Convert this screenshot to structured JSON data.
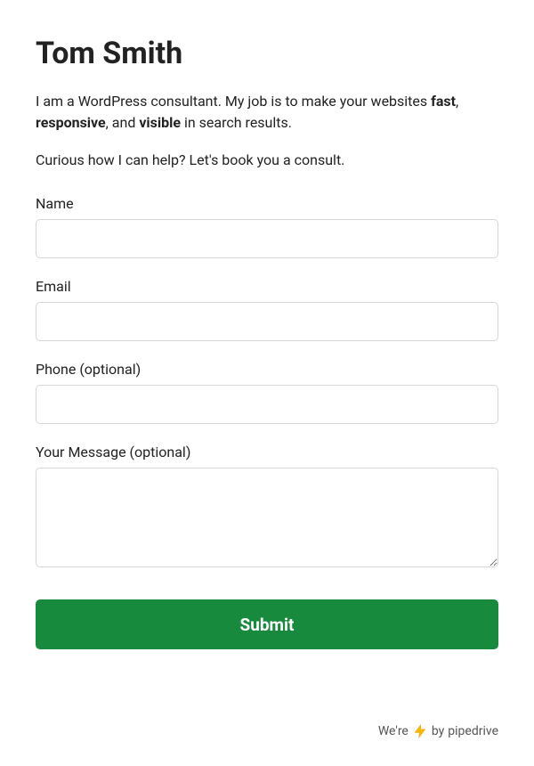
{
  "header": {
    "title": "Tom Smith"
  },
  "intro": {
    "prefix": "I am a WordPress consultant. My job is to make your websites ",
    "bold1": "fast",
    "sep1": ", ",
    "bold2": "responsive",
    "sep2": ", and ",
    "bold3": "visible",
    "suffix": " in search results."
  },
  "cta": "Curious how I can help? Let's book you a consult.",
  "form": {
    "name": {
      "label": "Name",
      "value": ""
    },
    "email": {
      "label": "Email",
      "value": ""
    },
    "phone": {
      "label": "Phone (optional)",
      "value": ""
    },
    "message": {
      "label": "Your Message (optional)",
      "value": ""
    },
    "submit_label": "Submit"
  },
  "footer": {
    "prefix": "We're",
    "suffix": "by",
    "brand": "pipedrive"
  },
  "colors": {
    "submit_bg": "#178a3e",
    "bolt_fill": "#f9b800"
  }
}
